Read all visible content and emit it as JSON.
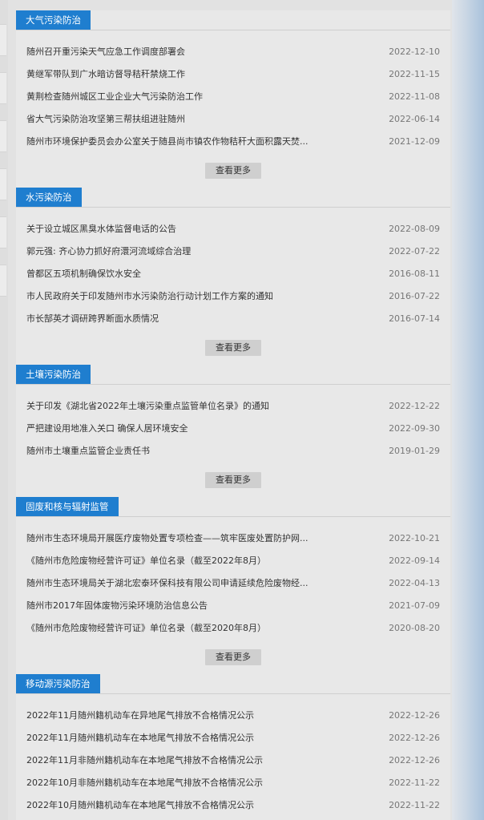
{
  "sections": [
    {
      "title": "大气污染防治",
      "more_label": "查看更多",
      "items": [
        {
          "title": "随州召开重污染天气应急工作调度部署会",
          "date": "2022-12-10"
        },
        {
          "title": "黄继军带队到广水暗访督导秸秆禁烧工作",
          "date": "2022-11-15"
        },
        {
          "title": "黄荆检查随州城区工业企业大气污染防治工作",
          "date": "2022-11-08"
        },
        {
          "title": "省大气污染防治攻坚第三帮扶组进驻随州",
          "date": "2022-06-14"
        },
        {
          "title": "随州市环境保护委员会办公室关于随县尚市镇农作物秸秆大面积露天焚...",
          "date": "2021-12-09"
        }
      ]
    },
    {
      "title": "水污染防治",
      "more_label": "查看更多",
      "items": [
        {
          "title": "关于设立城区黑臭水体监督电话的公告",
          "date": "2022-08-09"
        },
        {
          "title": "郭元强: 齐心协力抓好府澴河流域综合治理",
          "date": "2022-07-22"
        },
        {
          "title": "曾都区五项机制确保饮水安全",
          "date": "2016-08-11"
        },
        {
          "title": "市人民政府关于印发随州市水污染防治行动计划工作方案的通知",
          "date": "2016-07-22"
        },
        {
          "title": "市长郜英才调研跨界断面水质情况",
          "date": "2016-07-14"
        }
      ]
    },
    {
      "title": "土壤污染防治",
      "more_label": "查看更多",
      "items": [
        {
          "title": "关于印发《湖北省2022年土壤污染重点监管单位名录》的通知",
          "date": "2022-12-22"
        },
        {
          "title": "严把建设用地准入关口 确保人居环境安全",
          "date": "2022-09-30"
        },
        {
          "title": "随州市土壤重点监管企业责任书",
          "date": "2019-01-29"
        }
      ]
    },
    {
      "title": "固废和核与辐射监管",
      "more_label": "查看更多",
      "items": [
        {
          "title": "随州市生态环境局开展医疗废物处置专项检查——筑牢医废处置防护网...",
          "date": "2022-10-21"
        },
        {
          "title": "《随州市危险废物经营许可证》单位名录（截至2022年8月）",
          "date": "2022-09-14"
        },
        {
          "title": "随州市生态环境局关于湖北宏泰环保科技有限公司申请延续危险废物经...",
          "date": "2022-04-13"
        },
        {
          "title": "随州市2017年固体废物污染环境防治信息公告",
          "date": "2021-07-09"
        },
        {
          "title": "《随州市危险废物经营许可证》单位名录（截至2020年8月）",
          "date": "2020-08-20"
        }
      ]
    },
    {
      "title": "移动源污染防治",
      "more_label": "",
      "items": [
        {
          "title": "2022年11月随州籍机动车在异地尾气排放不合格情况公示",
          "date": "2022-12-26"
        },
        {
          "title": "2022年11月随州籍机动车在本地尾气排放不合格情况公示",
          "date": "2022-12-26"
        },
        {
          "title": "2022年11月非随州籍机动车在本地尾气排放不合格情况公示",
          "date": "2022-12-26"
        },
        {
          "title": "2022年10月非随州籍机动车在本地尾气排放不合格情况公示",
          "date": "2022-11-22"
        },
        {
          "title": "2022年10月随州籍机动车在本地尾气排放不合格情况公示",
          "date": "2022-11-22"
        }
      ]
    }
  ]
}
